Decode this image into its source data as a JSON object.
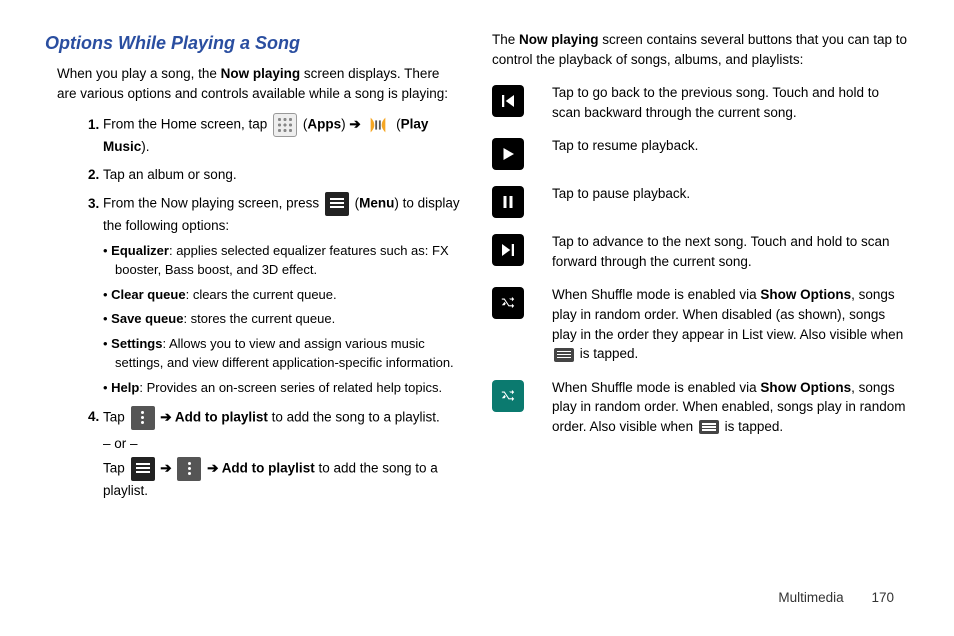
{
  "heading": "Options While Playing a Song",
  "intro_pre": "When you play a song, the ",
  "intro_bold": "Now playing",
  "intro_post": " screen displays. There are various options and controls available while a song is playing:",
  "step1_pre": "From the Home screen, tap ",
  "step1_apps": "Apps",
  "step1_playmusic": "Play Music",
  "step2": "Tap an album or song.",
  "step3_pre": "From the Now playing screen, press ",
  "step3_menu": "Menu",
  "step3_post": " to display the following options:",
  "bullets": {
    "eq_label": "Equalizer",
    "eq_text": ": applies selected equalizer features such as: FX booster, Bass boost, and 3D effect.",
    "clear_label": "Clear queue",
    "clear_text": ": clears the current queue.",
    "save_label": "Save queue",
    "save_text": ": stores the current queue.",
    "settings_label": "Settings",
    "settings_text": ": Allows you to view and assign various music settings, and view different application-specific information.",
    "help_label": "Help",
    "help_text": ": Provides an on-screen series of related help topics."
  },
  "step4_tap": "Tap ",
  "step4_arrow": " ➔ ",
  "step4_addto": "Add to playlist",
  "step4_end": " to add the song to a playlist.",
  "step4_or": "– or –",
  "step4b_end": " to add the song to a playlist.",
  "col2_intro_pre": "The ",
  "col2_intro_bold": "Now playing",
  "col2_intro_post": " screen contains several buttons that you can tap to control the playback of songs, albums, and playlists:",
  "icons": {
    "prev": "Tap to go back to the previous song. Touch and hold to scan backward through the current song.",
    "play": "Tap to resume playback.",
    "pause": "Tap to pause playback.",
    "next": "Tap to advance to the next song. Touch and hold to scan forward through the current song.",
    "shuffle_off_pre": "When Shuffle mode is enabled via ",
    "show_options": "Show Options",
    "shuffle_off_mid": ", songs play in random order. When disabled (as shown), songs play in the order they appear in List view. Also visible when ",
    "shuffle_off_post": " is tapped.",
    "shuffle_on_pre": "When Shuffle mode is enabled via ",
    "shuffle_on_mid": ", songs play in random order. When enabled, songs play in random order. Also visible when ",
    "shuffle_on_post": " is tapped."
  },
  "footer_section": "Multimedia",
  "footer_page": "170"
}
